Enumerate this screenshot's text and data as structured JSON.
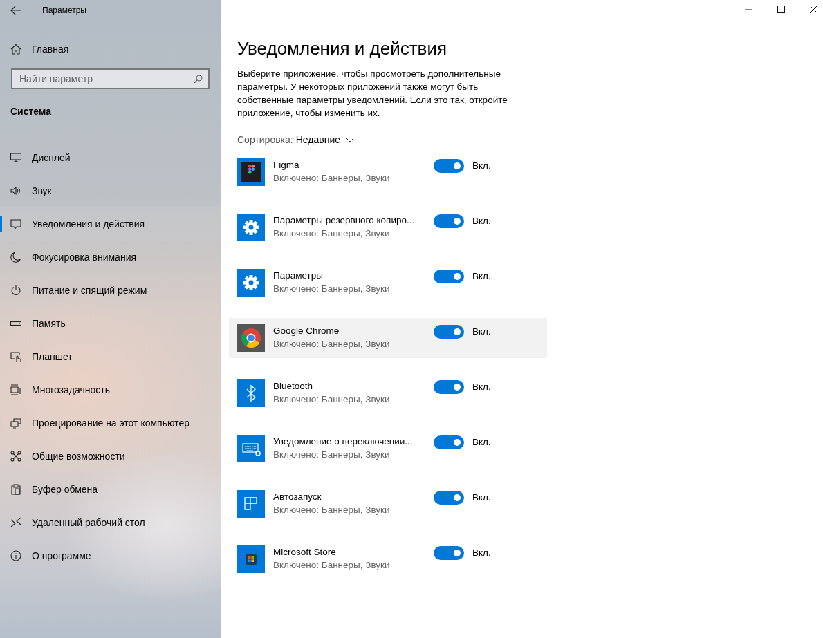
{
  "window": {
    "title": "Параметры"
  },
  "sidebar": {
    "home": "Главная",
    "search": {
      "placeholder": "Найти параметр"
    },
    "section": "Система",
    "items": [
      {
        "label": "Дисплей",
        "selected": false
      },
      {
        "label": "Звук",
        "selected": false
      },
      {
        "label": "Уведомления и действия",
        "selected": true
      },
      {
        "label": "Фокусировка внимания",
        "selected": false
      },
      {
        "label": "Питание и спящий режим",
        "selected": false
      },
      {
        "label": "Память",
        "selected": false
      },
      {
        "label": "Планшет",
        "selected": false
      },
      {
        "label": "Многозадачность",
        "selected": false
      },
      {
        "label": "Проецирование на этот компьютер",
        "selected": false
      },
      {
        "label": "Общие возможности",
        "selected": false
      },
      {
        "label": "Буфер обмена",
        "selected": false
      },
      {
        "label": "Удаленный рабочий стол",
        "selected": false
      },
      {
        "label": "О программе",
        "selected": false
      }
    ]
  },
  "main": {
    "title": "Уведомления и действия",
    "description": "Выберите приложение, чтобы просмотреть дополнительные параметры. У некоторых приложений также могут быть собственные параметры уведомлений. Если это так, откройте приложение, чтобы изменить их.",
    "sort": {
      "label": "Сортировка:",
      "value": "Недавние"
    },
    "apps": [
      {
        "name": "Figma",
        "status": "Включено: Баннеры, Звуки",
        "on": true,
        "state_label": "Вкл.",
        "highlighted": false
      },
      {
        "name": "Параметры резервного копиро...",
        "status": "Включено: Баннеры, Звуки",
        "on": true,
        "state_label": "Вкл.",
        "highlighted": false
      },
      {
        "name": "Параметры",
        "status": "Включено: Баннеры, Звуки",
        "on": true,
        "state_label": "Вкл.",
        "highlighted": false
      },
      {
        "name": "Google Chrome",
        "status": "Включено: Баннеры, Звуки",
        "on": true,
        "state_label": "Вкл.",
        "highlighted": true
      },
      {
        "name": "Bluetooth",
        "status": "Включено: Баннеры, Звуки",
        "on": true,
        "state_label": "Вкл.",
        "highlighted": false
      },
      {
        "name": "Уведомление о переключении...",
        "status": "Включено: Баннеры, Звуки",
        "on": true,
        "state_label": "Вкл.",
        "highlighted": false
      },
      {
        "name": "Автозапуск",
        "status": "Включено: Баннеры, Звуки",
        "on": true,
        "state_label": "Вкл.",
        "highlighted": false
      },
      {
        "name": "Microsoft Store",
        "status": "Включено: Баннеры, Звуки",
        "on": true,
        "state_label": "Вкл.",
        "highlighted": false
      }
    ]
  }
}
